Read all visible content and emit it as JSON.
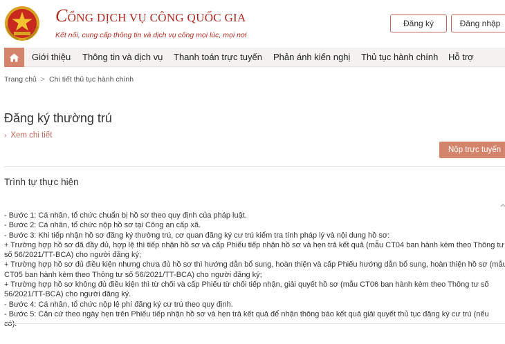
{
  "header": {
    "title_initial": "C",
    "title_rest": "ỔNG DỊCH VỤ CÔNG QUỐC GIA",
    "subtitle": "Kết nối, cung cấp thông tin và dịch vụ công mọi lúc, mọi nơi",
    "register_label": "Đăng ký",
    "login_label": "Đăng nhập",
    "brand_color": "#b32a20"
  },
  "nav": {
    "home_icon": "home-icon",
    "items": [
      {
        "label": "Giới thiệu"
      },
      {
        "label": "Thông tin và dịch vụ"
      },
      {
        "label": "Thanh toán trực tuyến"
      },
      {
        "label": "Phản ánh kiến nghị"
      },
      {
        "label": "Thủ tục hành chính"
      },
      {
        "label": "Hỗ trợ"
      }
    ],
    "accent_color": "#d5846c"
  },
  "breadcrumb": {
    "items": [
      {
        "label": "Trang chủ"
      },
      {
        "label": "Chi tiết thủ tục hành chính"
      }
    ],
    "separator": ">"
  },
  "main": {
    "title": "Đăng ký thường trú",
    "detail_link": "Xem chi tiết",
    "submit_label": "Nộp trực tuyến",
    "section_title": "Trình tự thực hiện",
    "steps": [
      "- Bước 1: Cá nhân, tổ chức chuẩn bị hồ sơ theo quy định của pháp luật.",
      "- Bước 2: Cá nhân, tổ chức nộp hồ sơ tại Công an cấp xã.",
      "- Bước 3: Khi tiếp nhận hồ sơ đăng ký thường trú, cơ quan đăng ký cư trú kiểm tra tính pháp lý và nội dung hồ sơ:",
      "+ Trường hợp hồ sơ đã đầy đủ, hợp lệ thì tiếp nhận hồ sơ và cấp Phiếu tiếp nhận hồ sơ và hẹn trả kết quả (mẫu CT04 ban hành kèm theo Thông tư",
      "số 56/2021/TT-BCA) cho người đăng ký;",
      "+ Trường hợp hồ sơ đủ điều kiện nhưng chưa đủ hồ sơ thì hướng dẫn bổ sung, hoàn thiện và cấp Phiếu hướng dẫn bổ sung, hoàn thiện hồ sơ (mẫu",
      "CT05 ban hành kèm theo Thông tư số 56/2021/TT-BCA) cho người đăng ký;",
      "+ Trường hợp hồ sơ không đủ điều kiện thì từ chối và cấp Phiếu từ chối tiếp nhận, giải quyết hồ sơ (mẫu CT06 ban hành kèm theo Thông tư số",
      "56/2021/TT-BCA) cho người đăng ký.",
      "- Bước 4: Cá nhân, tổ chức nộp lệ phí đăng ký cư trú theo quy định.",
      "- Bước 5: Căn cứ theo ngày hẹn trên Phiếu tiếp nhận hồ sơ và hẹn trả kết quả để nhận thông báo kết quả giải quyết thủ tục đăng ký cư trú (nếu",
      "có)."
    ]
  }
}
